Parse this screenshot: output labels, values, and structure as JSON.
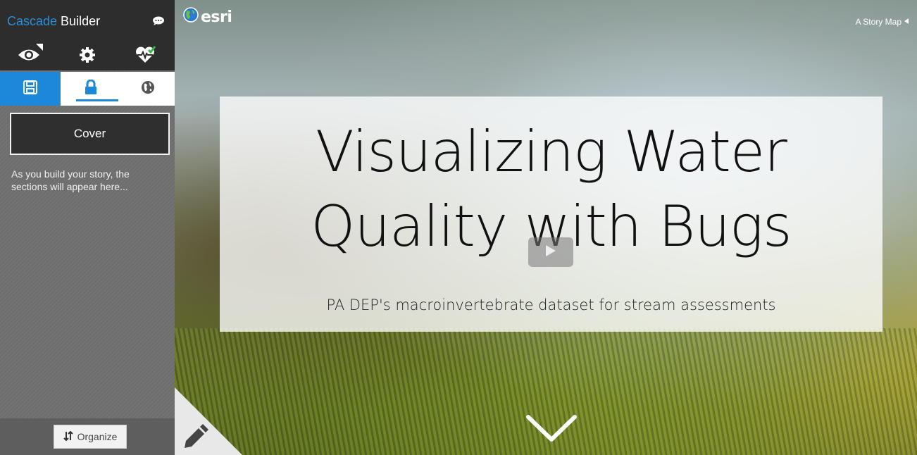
{
  "builder": {
    "title_accent": "Cascade",
    "title_rest": " Builder",
    "chat_icon": "chat-bubble-icon"
  },
  "toolbar": {
    "preview_icon": "eye-icon",
    "settings_icon": "gear-icon",
    "health_icon": "heartbeat-check-icon",
    "save_icon": "floppy-disk-icon",
    "lock_icon": "lock-icon",
    "globe_icon": "globe-icon"
  },
  "sections": {
    "cover_label": "Cover",
    "hint": "As you build your story, the sections will appear here..."
  },
  "footer": {
    "organize_label": "Organize"
  },
  "story": {
    "brand": "esri",
    "story_map_label": "A Story Map",
    "title": "Visualizing Water Quality with Bugs",
    "subtitle": "PA DEP's macroinvertebrate dataset for stream assessments"
  },
  "colors": {
    "accent_blue": "#1e88d8",
    "sidebar_dark": "#2d2d2d",
    "sidebar_grey": "#6e6e6e"
  }
}
